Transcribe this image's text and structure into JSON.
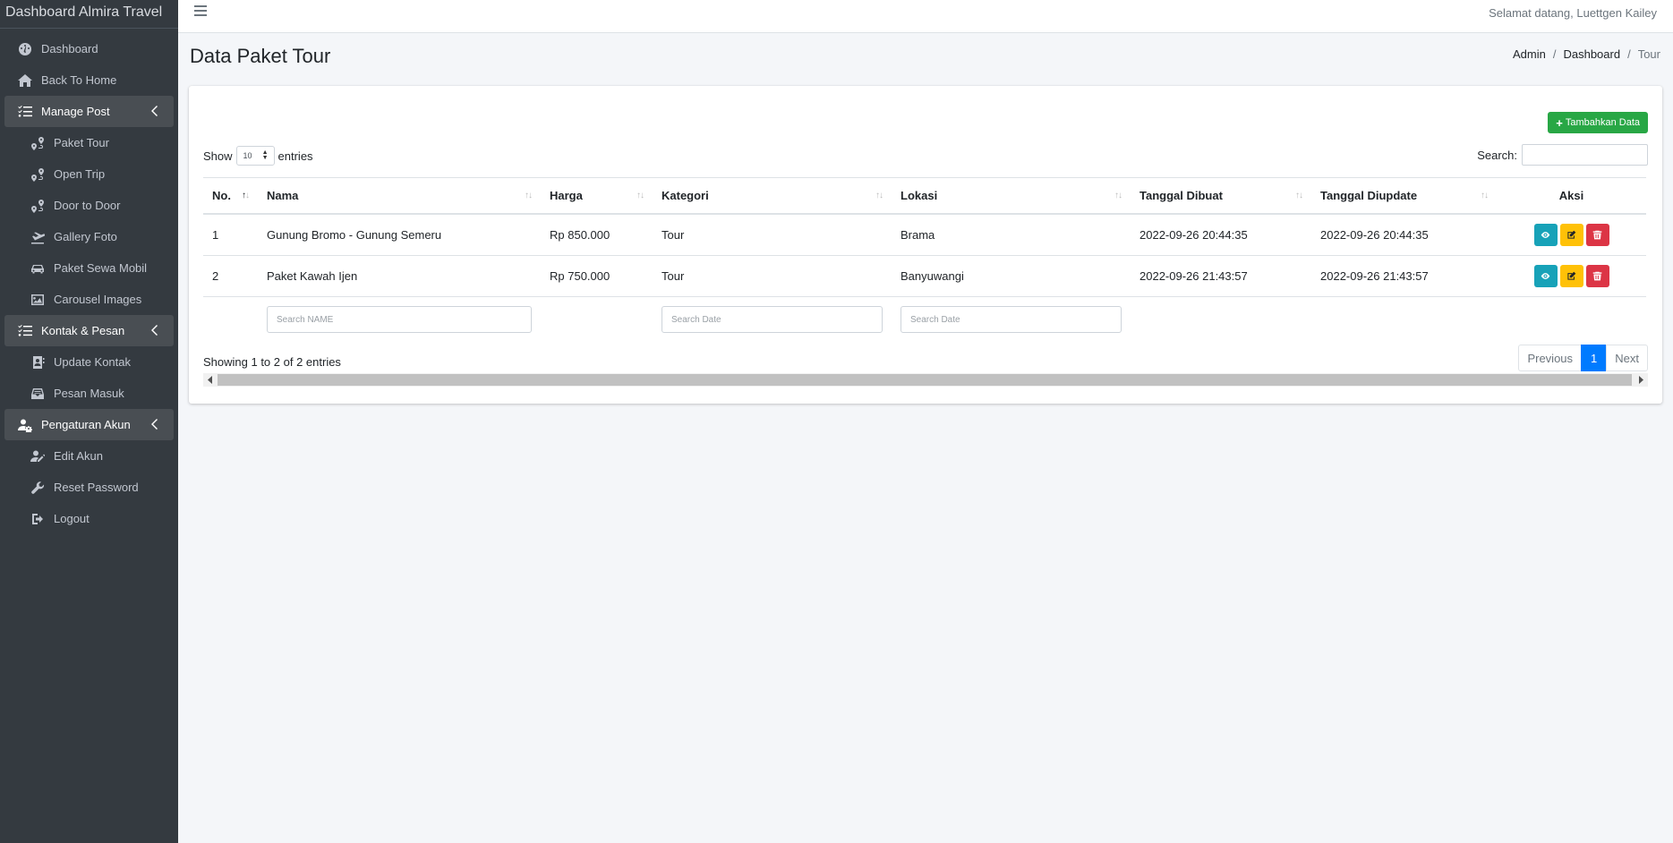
{
  "brand": "Dashboard Almira Travel",
  "sidebar": {
    "items": [
      {
        "label": "Dashboard",
        "icon": "tachometer-icon"
      },
      {
        "label": "Back To Home",
        "icon": "home-icon"
      },
      {
        "label": "Manage Post",
        "icon": "list-check-icon"
      },
      {
        "label": "Paket Tour",
        "icon": "route-icon"
      },
      {
        "label": "Open Trip",
        "icon": "route-icon"
      },
      {
        "label": "Door to Door",
        "icon": "route-icon"
      },
      {
        "label": "Gallery Foto",
        "icon": "plane-icon"
      },
      {
        "label": "Paket Sewa Mobil",
        "icon": "car-icon"
      },
      {
        "label": "Carousel Images",
        "icon": "image-icon"
      },
      {
        "label": "Kontak & Pesan",
        "icon": "list-check-icon"
      },
      {
        "label": "Update Kontak",
        "icon": "address-book-icon"
      },
      {
        "label": "Pesan Masuk",
        "icon": "inbox-icon"
      },
      {
        "label": "Pengaturan Akun",
        "icon": "user-cog-icon"
      },
      {
        "label": "Edit Akun",
        "icon": "user-edit-icon"
      },
      {
        "label": "Reset Password",
        "icon": "wrench-icon"
      },
      {
        "label": "Logout",
        "icon": "sign-out-icon"
      }
    ]
  },
  "topbar": {
    "welcome": "Selamat datang, Luettgen Kailey"
  },
  "page": {
    "title": "Data Paket Tour"
  },
  "breadcrumb": {
    "items": [
      "Admin",
      "Dashboard",
      "Tour"
    ]
  },
  "card": {
    "add_button": "Tambahkan Data",
    "show_label": "Show",
    "entries_label": "entries",
    "page_length": "10",
    "search_label": "Search:"
  },
  "table": {
    "headers": [
      "No.",
      "Nama",
      "Harga",
      "Kategori",
      "Lokasi",
      "Tanggal Dibuat",
      "Tanggal Diupdate",
      "Aksi"
    ],
    "rows": [
      [
        "1",
        "Gunung Bromo - Gunung Semeru",
        "Rp 850.000",
        "Tour",
        "Brama",
        "2022-09-26 20:44:35",
        "2022-09-26 20:44:35"
      ],
      [
        "2",
        "Paket Kawah Ijen",
        "Rp 750.000",
        "Tour",
        "Banyuwangi",
        "2022-09-26 21:43:57",
        "2022-09-26 21:43:57"
      ]
    ],
    "filters": {
      "nama": "Search NAME",
      "kategori": "Search Date",
      "lokasi": "Search Date"
    }
  },
  "footer": {
    "info": "Showing 1 to 2 of 2 entries",
    "previous": "Previous",
    "current_page": "1",
    "next": "Next"
  },
  "colors": {
    "sidebar": "#343a40",
    "success": "#28a745",
    "info": "#17a2b8",
    "warning": "#ffc107",
    "danger": "#dc3545",
    "primary": "#007bff"
  }
}
